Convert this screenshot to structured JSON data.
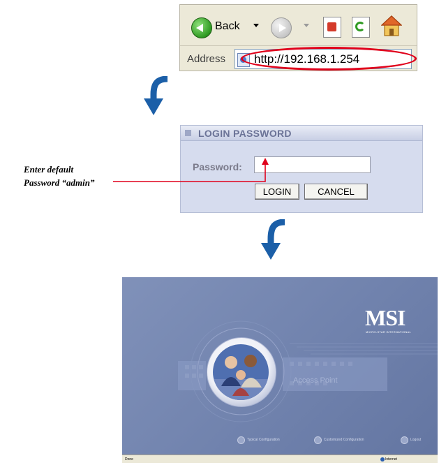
{
  "browser": {
    "back_label": "Back",
    "address_label": "Address",
    "url": "http://192.168.1.254",
    "highlight_color": "#e0001b",
    "icons": [
      "back-arrow-icon",
      "forward-arrow-icon",
      "stop-icon",
      "refresh-icon",
      "home-icon",
      "page-icon"
    ]
  },
  "login": {
    "title": "LOGIN PASSWORD",
    "password_label": "Password:",
    "password_value": "",
    "login_button": "LOGIN",
    "cancel_button": "CANCEL",
    "panel_color": "#d6dcee"
  },
  "annotation": {
    "line1": "Enter default",
    "line2": "Password “admin”",
    "line_color": "#e0001b"
  },
  "msi": {
    "logo": "MSI",
    "subtitle": "MICRO-STAR INTERNATIONAL",
    "product": "Access Point",
    "nav": [
      "Typical Configuration",
      "Customized Configuration",
      "Logout"
    ],
    "status_left": "Done",
    "status_right": "Internet",
    "background_color": "#7082ad"
  },
  "arrows": {
    "color": "#1b5fa8"
  }
}
